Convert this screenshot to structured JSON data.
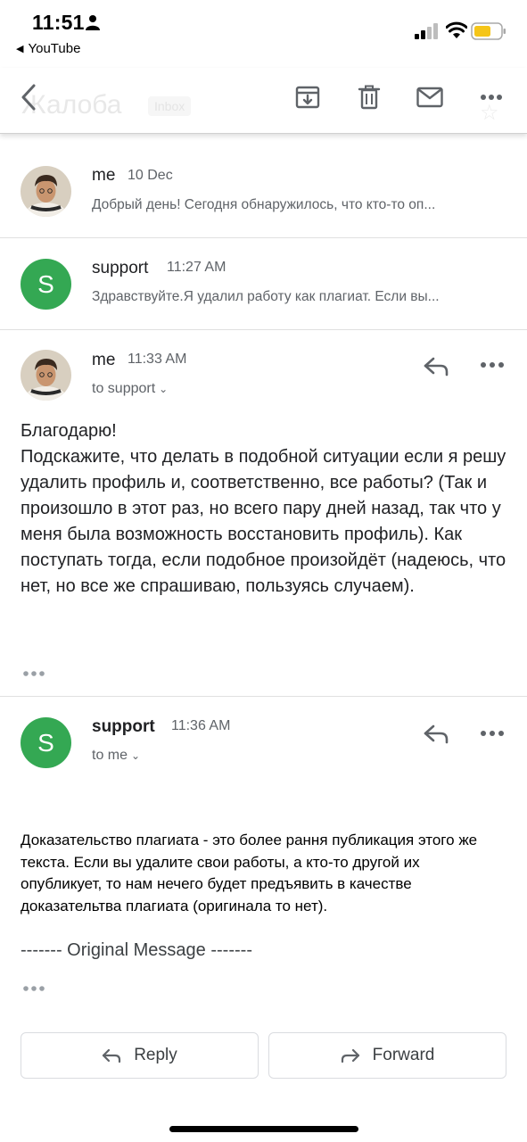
{
  "status_bar": {
    "time": "11:51",
    "back_app": "YouTube"
  },
  "toolbar": {
    "subject": "Жалоба",
    "badge": "Inbox",
    "icons": [
      "back-arrow-icon",
      "archive-icon",
      "trash-icon",
      "mail-icon",
      "more-icon"
    ]
  },
  "messages": [
    {
      "sender": "me",
      "date": "10 Dec",
      "snippet": "Добрый день! Сегодня обнаружилось, что кто-то оп..."
    },
    {
      "sender": "support",
      "avatar_letter": "S",
      "date": "11:27 AM",
      "snippet": "Здравствуйте.Я удалил работу как плагиат. Если вы..."
    },
    {
      "sender": "me",
      "date": "11:33 AM",
      "to": "to support",
      "body": [
        "Благодарю!",
        "Подскажите, что делать в подобной ситуации если я решу удалить профиль и, соответственно, все работы? (Так и произошло в этот раз, но всего пару дней назад, так что у меня была возможность восстановить профиль). Как поступать тогда, если подобное произойдёт (надеюсь, что нет, но все же спрашиваю, пользуясь случаем)."
      ]
    },
    {
      "sender": "support",
      "avatar_letter": "S",
      "date": "11:36 AM",
      "to": "to me",
      "body": "Доказательство плагиата - это более рання публикация этого же текста. Если вы удалите свои работы, а кто-то другой их опубликует, то нам нечего будет предъявить в качестве доказательтва плагиата (оригинала то нет).",
      "original_message": "------- Original Message -------"
    }
  ],
  "actions": {
    "reply": "Reply",
    "forward": "Forward"
  },
  "colors": {
    "avatar_green": "#34a853",
    "text_primary": "#202124",
    "text_secondary": "#5f6368",
    "battery_yellow": "#f5c518"
  }
}
